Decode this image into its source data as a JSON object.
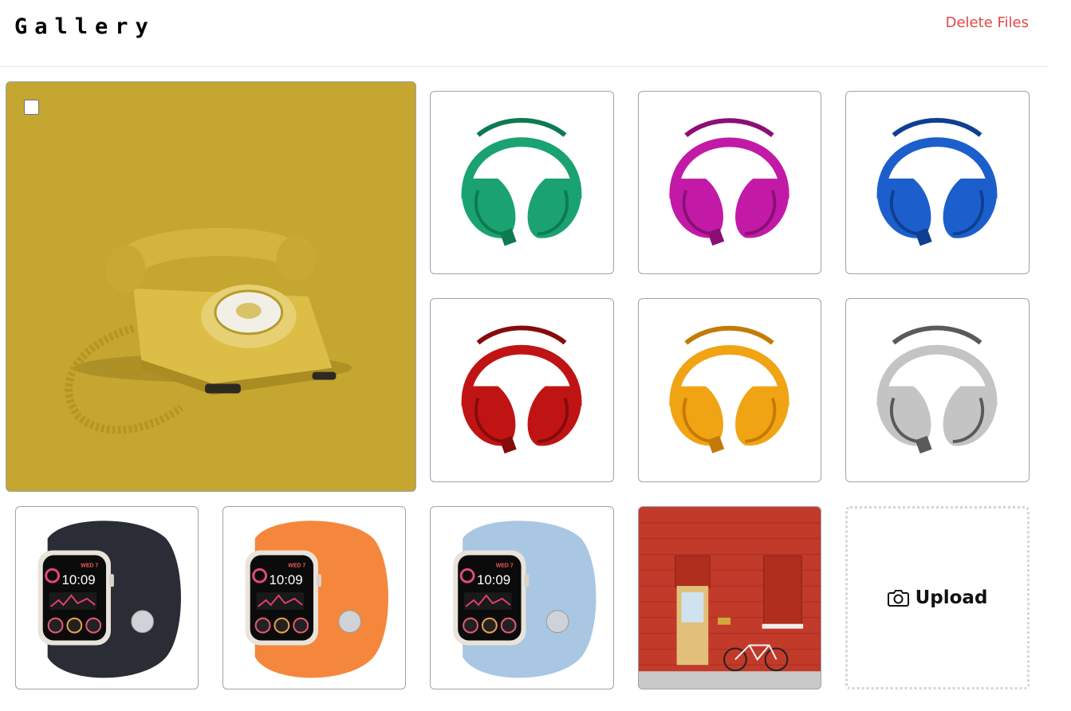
{
  "header": {
    "title": "Gallery",
    "delete_label": "Delete Files"
  },
  "featured": {
    "icon": "rotary-telephone-icon",
    "background": "#c5a630",
    "checked": false
  },
  "headphones": [
    {
      "color": "#1aa370",
      "dark": "#0d7a50"
    },
    {
      "color": "#c21aa6",
      "dark": "#8a0f77"
    },
    {
      "color": "#1c5fcc",
      "dark": "#0f3f92"
    },
    {
      "color": "#c01414",
      "dark": "#860b0b"
    },
    {
      "color": "#f0a414",
      "dark": "#c47a06"
    },
    {
      "color": "#c4c4c4",
      "dark": "#5a5a5a"
    }
  ],
  "watches": [
    {
      "band": "#2a2d36",
      "time": "10:09",
      "day": "WED 7"
    },
    {
      "band": "#f5873d",
      "time": "10:09",
      "day": "WED 7"
    },
    {
      "band": "#a9c7e3",
      "time": "10:09",
      "day": "WED 7"
    }
  ],
  "door_photo": {
    "icon": "red-brick-door-bicycle-image",
    "wall": "#c23a2a"
  },
  "upload": {
    "label": "Upload",
    "icon": "camera-icon"
  }
}
